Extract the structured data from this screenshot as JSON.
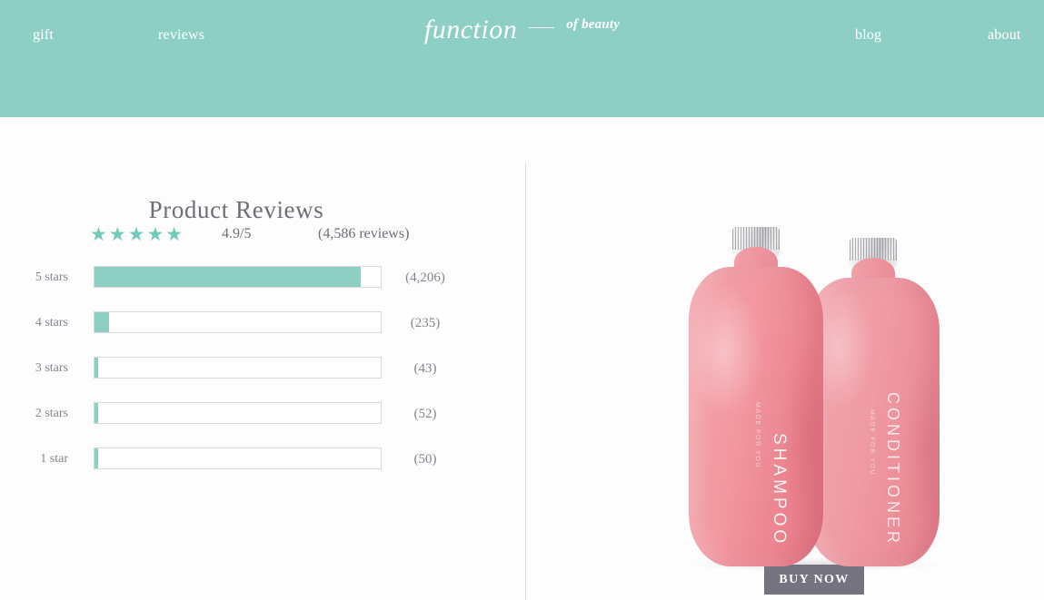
{
  "header": {
    "background_color": "#8ecfc5",
    "nav": [
      {
        "id": "gift",
        "label": "gift"
      },
      {
        "id": "reviews",
        "label": "reviews"
      },
      {
        "id": "blog",
        "label": "blog"
      },
      {
        "id": "about",
        "label": "about"
      }
    ],
    "brand": {
      "main": "function",
      "sub": "of beauty"
    }
  },
  "reviews": {
    "title": "Product Reviews",
    "stars_display": "★★★★★",
    "score": "4.9/5",
    "count_label": "(4,586 reviews)",
    "accent_color": "#73c9ba",
    "bars": [
      {
        "label": "5 stars",
        "count_label": "(4,206)",
        "percent": 93
      },
      {
        "label": "4 stars",
        "count_label": "(235)",
        "percent": 5
      },
      {
        "label": "3 stars",
        "count_label": "(43)",
        "percent": 1.2
      },
      {
        "label": "2 stars",
        "count_label": "(52)",
        "percent": 1.2
      },
      {
        "label": "1 star",
        "count_label": "(50)",
        "percent": 1.2
      }
    ]
  },
  "product": {
    "bottle_left": {
      "name": "SHAMPOO",
      "subtext": "MADE FOR YOU"
    },
    "bottle_right": {
      "name": "CONDITIONER",
      "subtext": "MADE FOR YOU"
    },
    "buy_button": {
      "label": "BUY NOW",
      "color": "#74737f"
    }
  },
  "chart_data": {
    "type": "bar",
    "title": "Product Reviews rating distribution",
    "categories": [
      "5 stars",
      "4 stars",
      "3 stars",
      "2 stars",
      "1 star"
    ],
    "values": [
      4206,
      235,
      43,
      52,
      50
    ],
    "value_labels": [
      "(4,206)",
      "(235)",
      "(43)",
      "(52)",
      "(50)"
    ],
    "percent_of_max": [
      93,
      5,
      1.2,
      1.2,
      1.2
    ],
    "total_reviews": 4586,
    "average_rating": 4.9,
    "rating_scale_max": 5,
    "xlabel": "",
    "ylabel": "",
    "grid": false,
    "orientation": "horizontal",
    "bar_color": "#8ecfc3",
    "track_color": "#ffffff",
    "track_border_color": "#d8d8dc"
  }
}
